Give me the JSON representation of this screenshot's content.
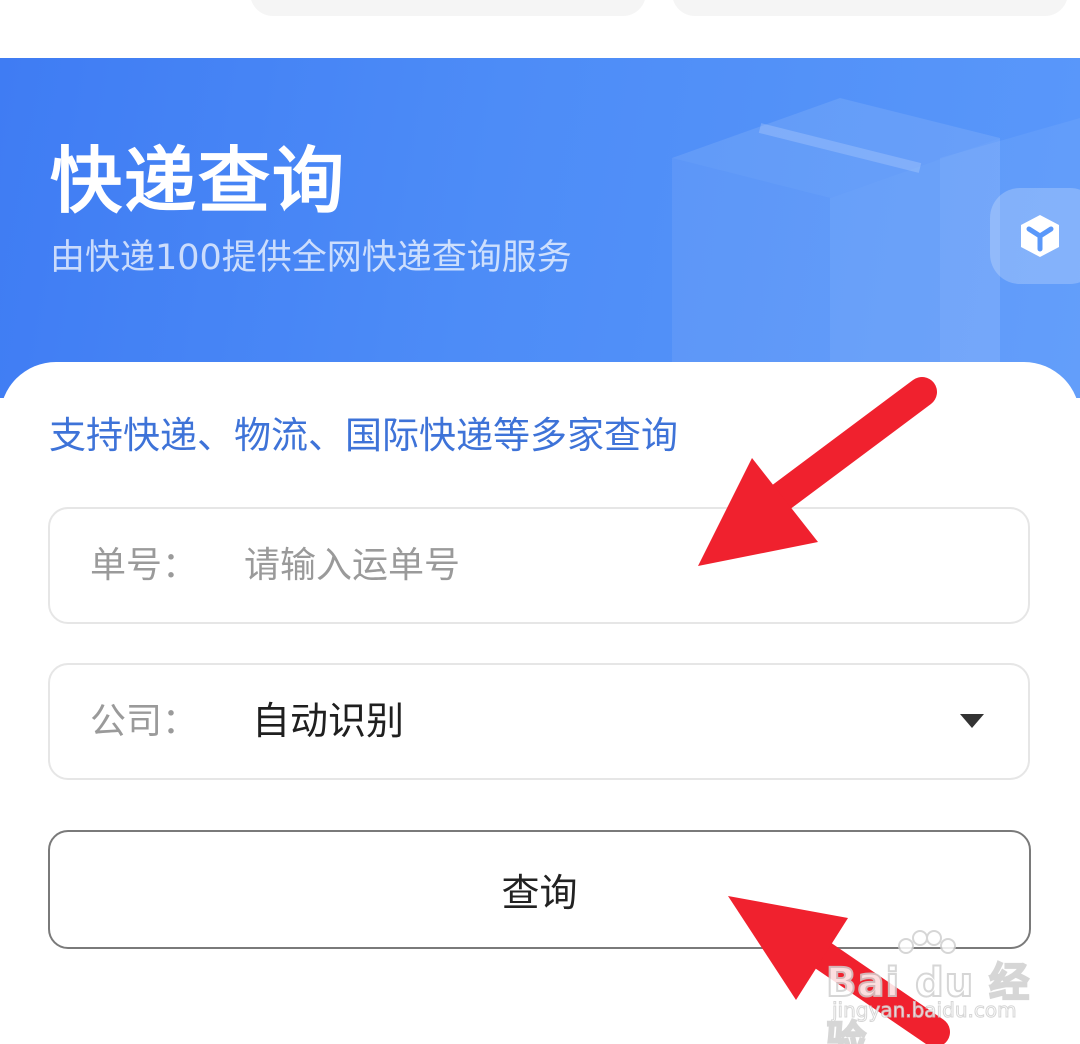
{
  "banner": {
    "title": "快递查询",
    "subtitle": "由快递100提供全网快递查询服务",
    "badge_icon": "cube-icon"
  },
  "form": {
    "hint": "支持快递、物流、国际快递等多家查询",
    "tracking": {
      "label": "单号：",
      "value": "",
      "placeholder": "请输入运单号"
    },
    "company": {
      "label": "公司：",
      "selected": "自动识别",
      "caret_icon": "caret-down-icon"
    },
    "submit_label": "查询"
  },
  "watermark": {
    "brand": "Bai du 经验",
    "url": "jingyan.baidu.com"
  },
  "colors": {
    "banner_blue": "#4d8cf7",
    "hint_blue": "#3e73d8",
    "annotation_red": "#f0212e"
  }
}
